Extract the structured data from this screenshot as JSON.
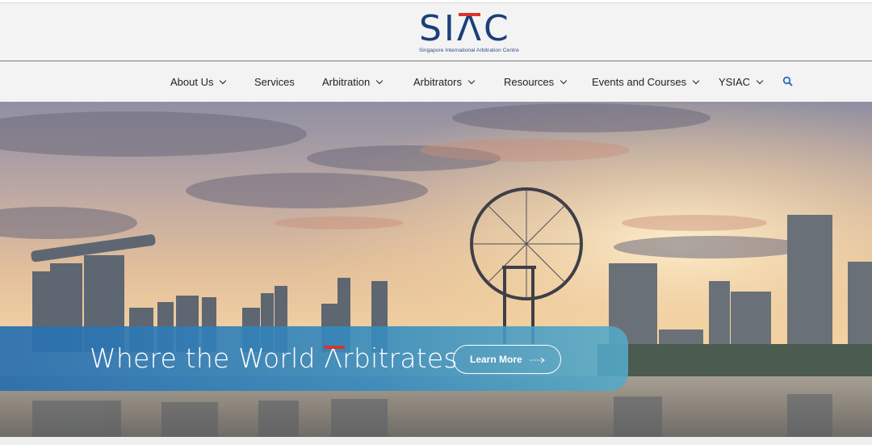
{
  "logo": {
    "mark_part1": "SI",
    "mark_part2": "Λ",
    "mark_part3": "C",
    "subtitle": "Singapore International Arbitration Centre",
    "colors": {
      "navy": "#1c3f7a",
      "red": "#d9342b"
    }
  },
  "nav": {
    "items": [
      {
        "label": "About Us",
        "has_dropdown": true
      },
      {
        "label": "Services",
        "has_dropdown": false
      },
      {
        "label": "Arbitration",
        "has_dropdown": true
      },
      {
        "label": "Arbitrators",
        "has_dropdown": true
      },
      {
        "label": "Resources",
        "has_dropdown": true
      },
      {
        "label": "Events and Courses",
        "has_dropdown": true
      },
      {
        "label": "YSIAC",
        "has_dropdown": true
      }
    ],
    "search_icon": "search-icon"
  },
  "hero": {
    "title_before": "Where the World ",
    "title_mark": "Λ",
    "title_after": "rbitrates",
    "cta_label": "Learn More",
    "cta_icon": "arrow-right-icon",
    "banner_color": "#2e78b4"
  }
}
